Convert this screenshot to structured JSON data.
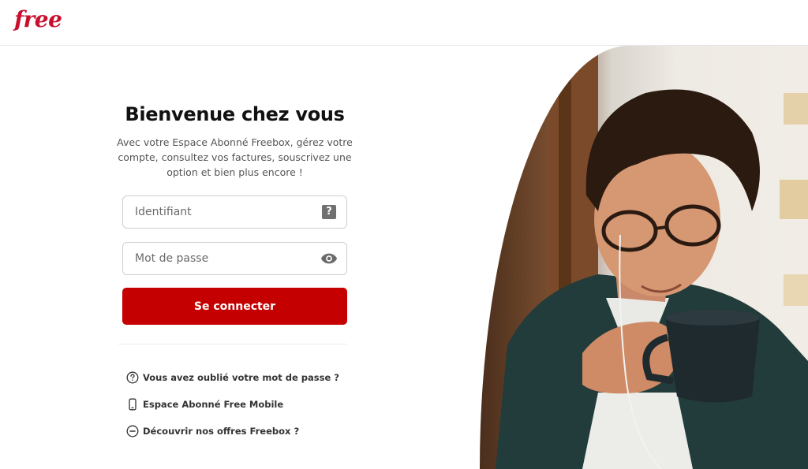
{
  "header": {
    "logo_text": "free",
    "brand_color": "#c8102e"
  },
  "login": {
    "title": "Bienvenue chez vous",
    "subtitle": "Avec votre Espace Abonné Freebox, gérez votre compte, consultez vos factures, souscrivez une option et bien plus encore !",
    "username_placeholder": "Identifiant",
    "username_value": "",
    "password_placeholder": "Mot de passe",
    "password_value": "",
    "submit_label": "Se connecter",
    "submit_color": "#c50000"
  },
  "links": [
    {
      "label": "Vous avez oublié votre mot de passe ?",
      "icon": "question-circle-icon"
    },
    {
      "label": "Espace Abonné Free Mobile",
      "icon": "smartphone-icon"
    },
    {
      "label": "Découvrir nos offres Freebox ?",
      "icon": "minus-circle-icon"
    }
  ],
  "icons": {
    "username_help": "help-square-icon",
    "password_toggle": "eye-icon"
  }
}
